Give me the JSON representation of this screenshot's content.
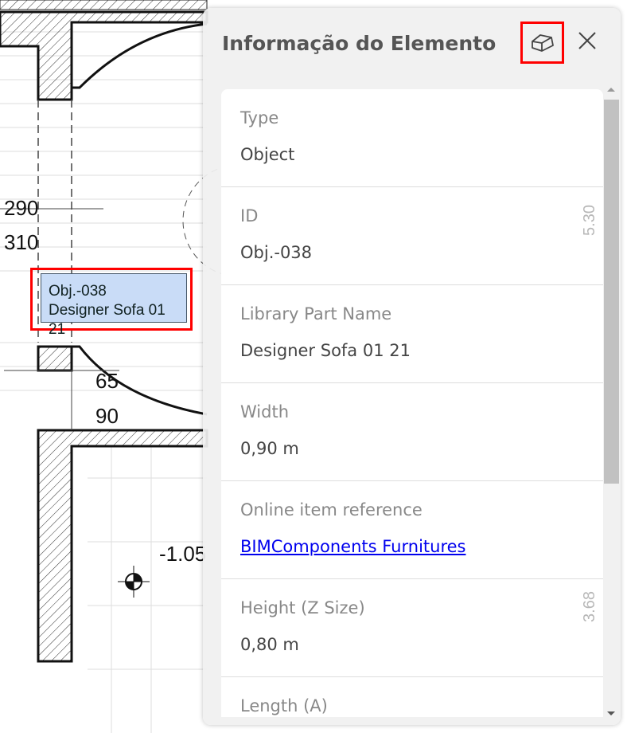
{
  "plan": {
    "dimensions": [
      "290",
      "310",
      "65",
      "90",
      "-1.05",
      "5.30",
      "3.68"
    ],
    "tag": {
      "id": "Obj.-038",
      "name": "Designer Sofa 01 21"
    }
  },
  "panel": {
    "title": "Informação do Elemento",
    "rows": [
      {
        "label": "Type",
        "value": "Object"
      },
      {
        "label": "ID",
        "value": "Obj.-038"
      },
      {
        "label": "Library Part Name",
        "value": "Designer Sofa 01 21"
      },
      {
        "label": "Width",
        "value": "0,90 m"
      },
      {
        "label": "Online item reference",
        "link": "BIMComponents Furnitures"
      },
      {
        "label": "Height (Z Size)",
        "value": "0,80 m"
      },
      {
        "label": "Length (A)",
        "value": ""
      }
    ]
  }
}
